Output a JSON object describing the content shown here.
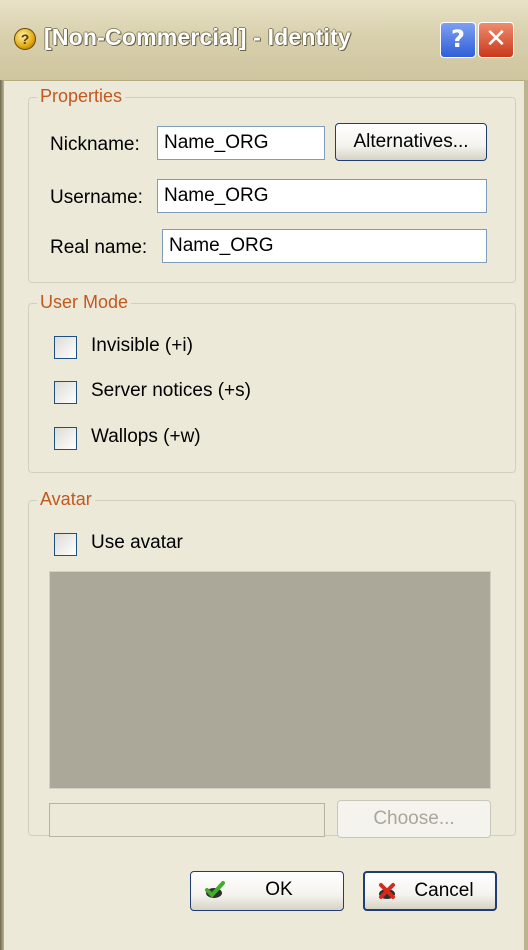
{
  "window": {
    "title": "[Non-Commercial] - Identity",
    "help_button": "?",
    "close_button": "✕"
  },
  "properties": {
    "legend": "Properties",
    "nickname_label": "Nickname:",
    "nickname_value": "Name_ORG",
    "alternatives_button": "Alternatives...",
    "username_label": "Username:",
    "username_value": "Name_ORG",
    "realname_label": "Real name:",
    "realname_value": "Name_ORG"
  },
  "user_mode": {
    "legend": "User Mode",
    "invisible_label": "Invisible (+i)",
    "server_notices_label": "Server notices (+s)",
    "wallops_label": "Wallops (+w)"
  },
  "avatar": {
    "legend": "Avatar",
    "use_avatar_label": "Use avatar",
    "choose_button": "Choose..."
  },
  "footer": {
    "ok_button": "OK",
    "cancel_button": "Cancel"
  },
  "icons": {
    "app_icon": "app-icon",
    "ok_icon": "green-check-icon",
    "cancel_icon": "red-x-icon"
  },
  "colors": {
    "legend_text": "#c1581f",
    "dialog_bg": "#ece9d8",
    "avatar_preview": "#aba89a"
  }
}
